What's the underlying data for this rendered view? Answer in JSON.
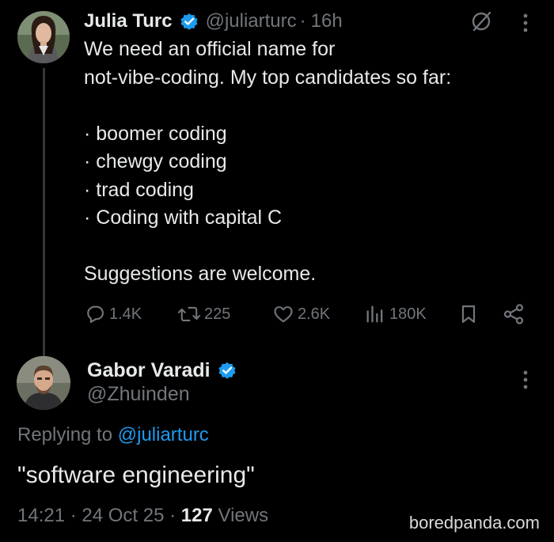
{
  "tweet": {
    "author_name": "Julia Turc",
    "handle": "@juliarturc",
    "separator": "·",
    "time": "16h",
    "lines": [
      "We need an official name for",
      "not-vibe-coding. My top candidates so far:",
      "",
      "· boomer coding",
      "· chewgy coding",
      "· trad coding",
      "· Coding with capital C",
      "",
      "Suggestions are welcome."
    ],
    "stats": {
      "replies": "1.4K",
      "reposts": "225",
      "likes": "2.6K",
      "views": "180K"
    }
  },
  "reply": {
    "author_name": "Gabor Varadi",
    "handle": "@Zhuinden",
    "replying_prefix": "Replying to ",
    "replying_to": "@juliarturc",
    "text": "\"software engineering\"",
    "time": "14:21",
    "sep1": " · ",
    "date": "24 Oct 25",
    "sep2": " · ",
    "views_count": "127",
    "views_label": " Views"
  },
  "watermark": "boredpanda.com",
  "colors": {
    "background": "#000000",
    "text": "#e7e9ea",
    "muted": "#71767b",
    "accent": "#1d9bf0",
    "verified": "#1d9bf0"
  },
  "icons": {
    "verified": "verified-badge-icon",
    "grok": "grok-icon",
    "more": "more-vertical-icon",
    "reply": "reply-icon",
    "repost": "repost-icon",
    "like": "heart-icon",
    "views": "views-chart-icon",
    "bookmark": "bookmark-icon",
    "share": "share-icon"
  }
}
